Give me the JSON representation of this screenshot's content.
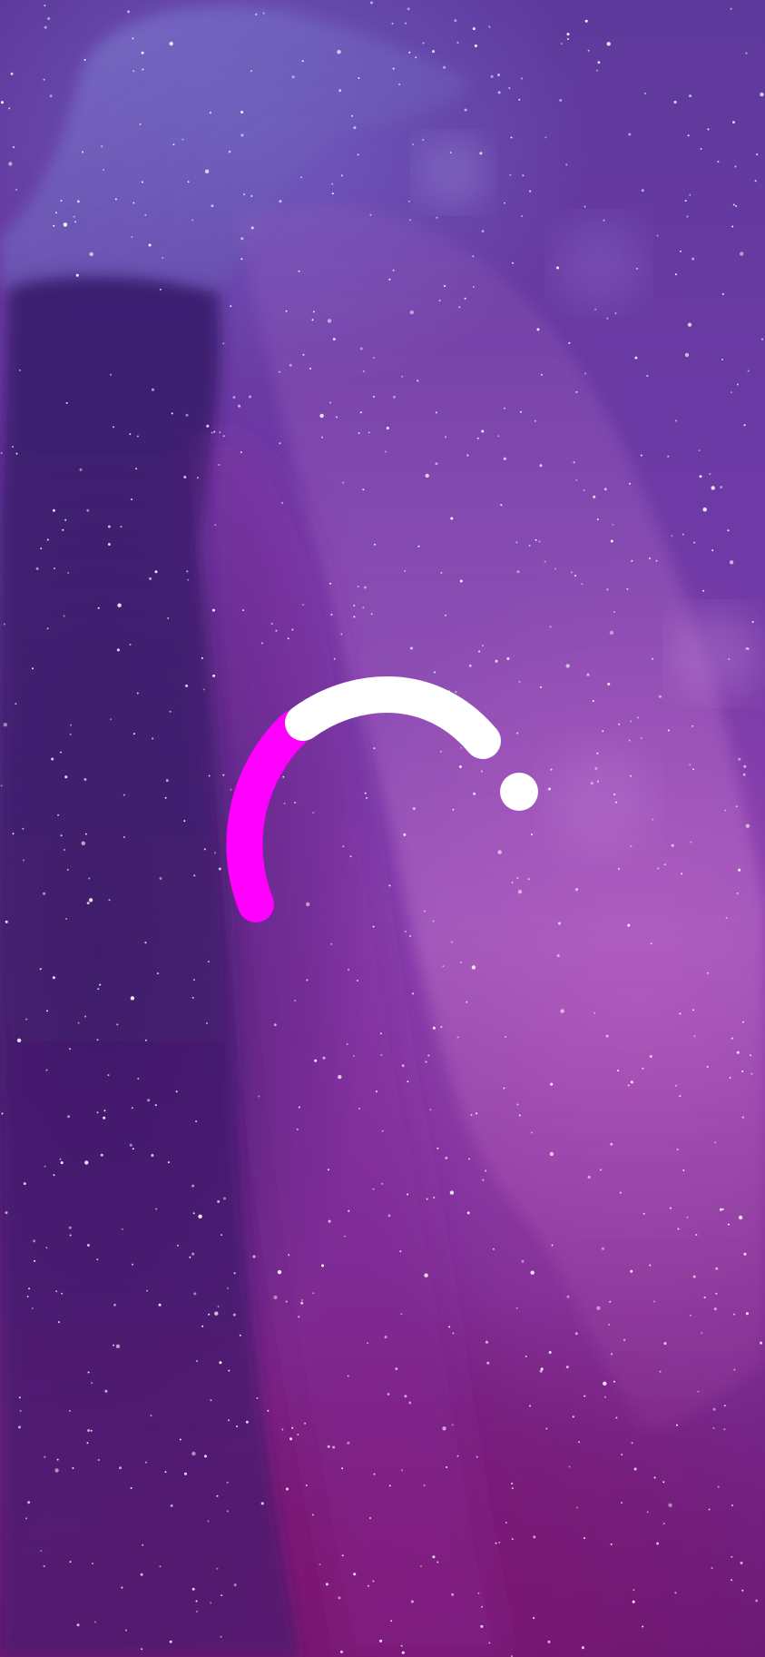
{
  "screen": {
    "name": "loading-screen",
    "background_tint": "#7a3aa8"
  },
  "loader": {
    "type": "circular-spinner",
    "arc_primary_color": "#ffffff",
    "arc_accent_color": "#ff00ff",
    "dot_color": "#ffffff"
  },
  "background": {
    "description_icon": "concert-hands-photo",
    "sparkle_color": "#ffffff"
  }
}
